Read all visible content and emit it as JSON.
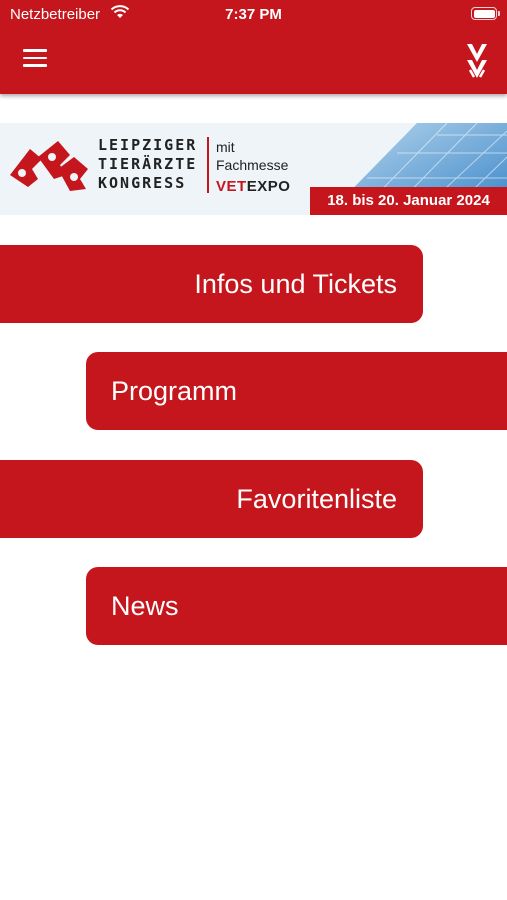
{
  "status_bar": {
    "carrier": "Netzbetreiber",
    "time": "7:37 PM"
  },
  "header": {
    "menu_icon": "hamburger-icon",
    "logo_icon": "mm-logo-icon"
  },
  "banner": {
    "title_lines": [
      "LEIPZIGER",
      "TIERÄRZTE",
      "KONGRESS"
    ],
    "mit": "mit",
    "fachmesse": "Fachmesse",
    "vet": "VET",
    "expo": "EXPO",
    "dates": "18. bis 20. Januar 2024",
    "colors": {
      "red": "#c4161c",
      "blue": "#4a90d9"
    }
  },
  "nav": [
    {
      "label": "Infos und Tickets"
    },
    {
      "label": "Programm"
    },
    {
      "label": "Favoritenliste"
    },
    {
      "label": "News"
    }
  ],
  "colors": {
    "accent": "#c4161c",
    "background": "#ffffff"
  }
}
